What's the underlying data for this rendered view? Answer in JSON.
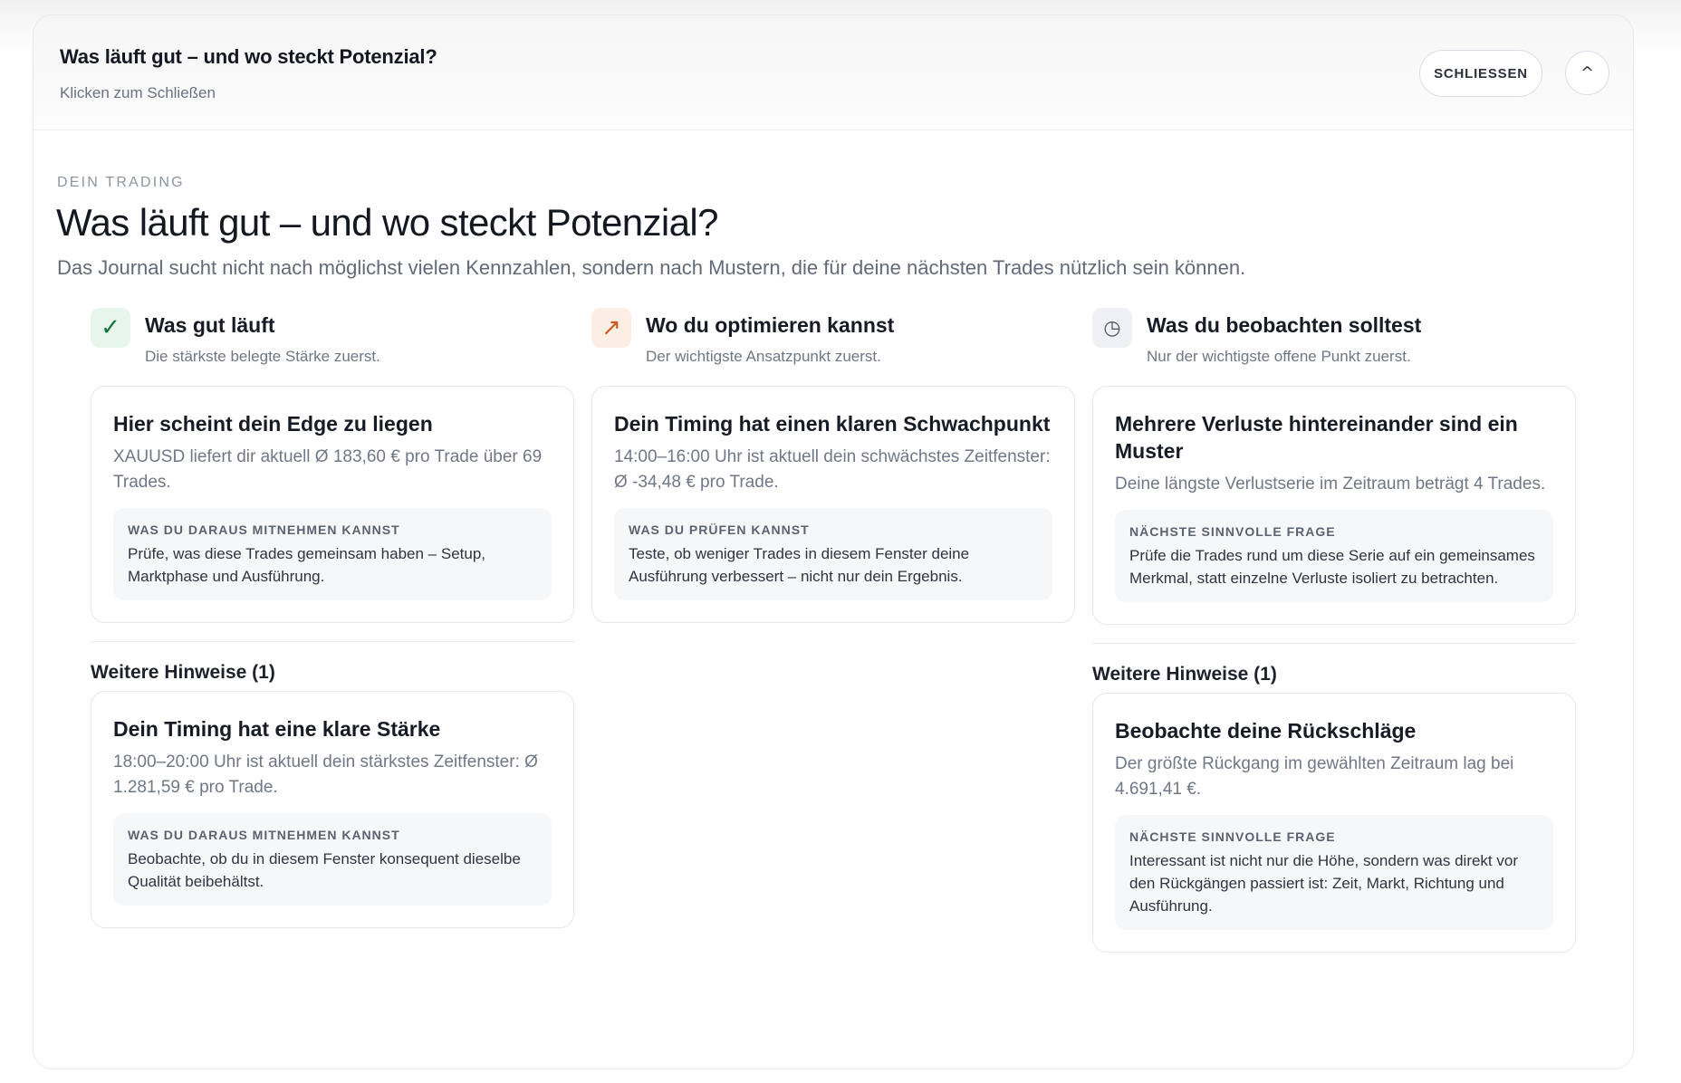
{
  "panel": {
    "title": "Was läuft gut – und wo steckt Potenzial?",
    "subtitle": "Klicken zum Schließen",
    "close_label": "SCHLIESSEN",
    "collapse_glyph": "^"
  },
  "section": {
    "eyebrow": "DEIN TRADING",
    "title": "Was läuft gut – und wo steckt Potenzial?",
    "description": "Das Journal sucht nicht nach möglichst vielen Kennzahlen, sondern nach Mustern, die für deine nächsten Trades nützlich sein können."
  },
  "columns": [
    {
      "icon": "check-icon",
      "icon_glyph": "✓",
      "accent": "#13753a",
      "title": "Was gut läuft",
      "subtitle": "Die stärkste belegte Stärke zuerst.",
      "card": {
        "title": "Hier scheint dein Edge zu liegen",
        "body": "XAUUSD liefert dir aktuell Ø 183,60 € pro Trade über 69 Trades.",
        "tip_label": "WAS DU DARAUS MITNEHMEN KANNST",
        "tip_text": "Prüfe, was diese Trades gemeinsam haben – Setup, Marktphase und Ausführung."
      },
      "more_label": "Weitere Hinweise (1)",
      "more_card": {
        "title": "Dein Timing hat eine klare Stärke",
        "body": "18:00–20:00 Uhr ist aktuell dein stärkstes Zeitfenster: Ø 1.281,59 € pro Trade.",
        "tip_label": "WAS DU DARAUS MITNEHMEN KANNST",
        "tip_text": "Beobachte, ob du in diesem Fenster konsequent dieselbe Qualität beibehältst."
      }
    },
    {
      "icon": "trend-arrow-icon",
      "icon_glyph": "↗",
      "accent": "#cc5a1f",
      "title": "Wo du optimieren kannst",
      "subtitle": "Der wichtigste Ansatzpunkt zuerst.",
      "card": {
        "title": "Dein Timing hat einen klaren Schwachpunkt",
        "body": "14:00–16:00 Uhr ist aktuell dein schwächstes Zeitfenster: Ø -34,48 € pro Trade.",
        "tip_label": "WAS DU PRÜFEN KANNST",
        "tip_text": "Teste, ob weniger Trades in diesem Fenster deine Ausführung verbessert – nicht nur dein Ergebnis."
      }
    },
    {
      "icon": "clock-icon",
      "icon_glyph": "◷",
      "accent": "#4b5260",
      "title": "Was du beobachten solltest",
      "subtitle": "Nur der wichtigste offene Punkt zuerst.",
      "card": {
        "title": "Mehrere Verluste hintereinander sind ein Muster",
        "body": "Deine längste Verlustserie im Zeitraum beträgt 4 Trades.",
        "tip_label": "NÄCHSTE SINNVOLLE FRAGE",
        "tip_text": "Prüfe die Trades rund um diese Serie auf ein gemeinsames Merkmal, statt einzelne Verluste isoliert zu betrachten."
      },
      "more_label": "Weitere Hinweise (1)",
      "more_card": {
        "title": "Beobachte deine Rückschläge",
        "body": "Der größte Rückgang im gewählten Zeitraum lag bei 4.691,41 €.",
        "tip_label": "NÄCHSTE SINNVOLLE FRAGE",
        "tip_text": "Interessant ist nicht nur die Höhe, sondern was direkt vor den Rückgängen passiert ist: Zeit, Markt, Richtung und Ausführung."
      }
    }
  ]
}
